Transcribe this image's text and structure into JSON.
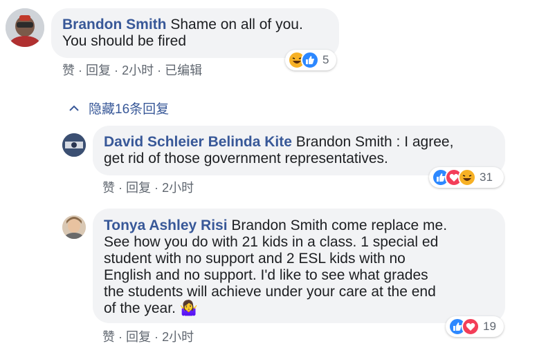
{
  "comments": [
    {
      "author": "Brandon Smith",
      "text": "Shame on all of you.",
      "text_line2": "You should be fired",
      "reactions": [
        "haha",
        "like"
      ],
      "reaction_count": "5",
      "actions": {
        "like": "赞",
        "reply": "回复",
        "time": "2小时",
        "edited": "已编辑",
        "sep": "·"
      }
    }
  ],
  "hide_replies": {
    "label": "隐藏16条回复"
  },
  "replies": [
    {
      "author": "David Schleier Belinda Kite",
      "text_line1": "Brandon Smith : I agree,",
      "text_line2": "get rid of those government representatives.",
      "reactions": [
        "like",
        "love",
        "haha"
      ],
      "reaction_count": "31",
      "actions": {
        "like": "赞",
        "reply": "回复",
        "time": "2小时",
        "sep": "·"
      }
    },
    {
      "author": "Tonya Ashley Risi",
      "text_line1": "Brandon Smith come replace me.",
      "text_line2": "See how you do with 21 kids in a class. 1 special ed",
      "text_line3": "student with no support and 2 ESL kids with no",
      "text_line4": "English and no support. I'd like to see what grades",
      "text_line5": "the students will achieve under your care at the end",
      "text_line6": "of the year. 🤷‍♀️",
      "reactions": [
        "like",
        "love"
      ],
      "reaction_count": "19",
      "actions": {
        "like": "赞",
        "reply": "回复",
        "time": "2小时",
        "sep": "·"
      }
    }
  ],
  "colors": {
    "link": "#385898",
    "bubble": "#f2f3f5",
    "meta": "#606770",
    "like": "#2d88ff",
    "love": "#f33e58",
    "haha": "#f7b125"
  }
}
